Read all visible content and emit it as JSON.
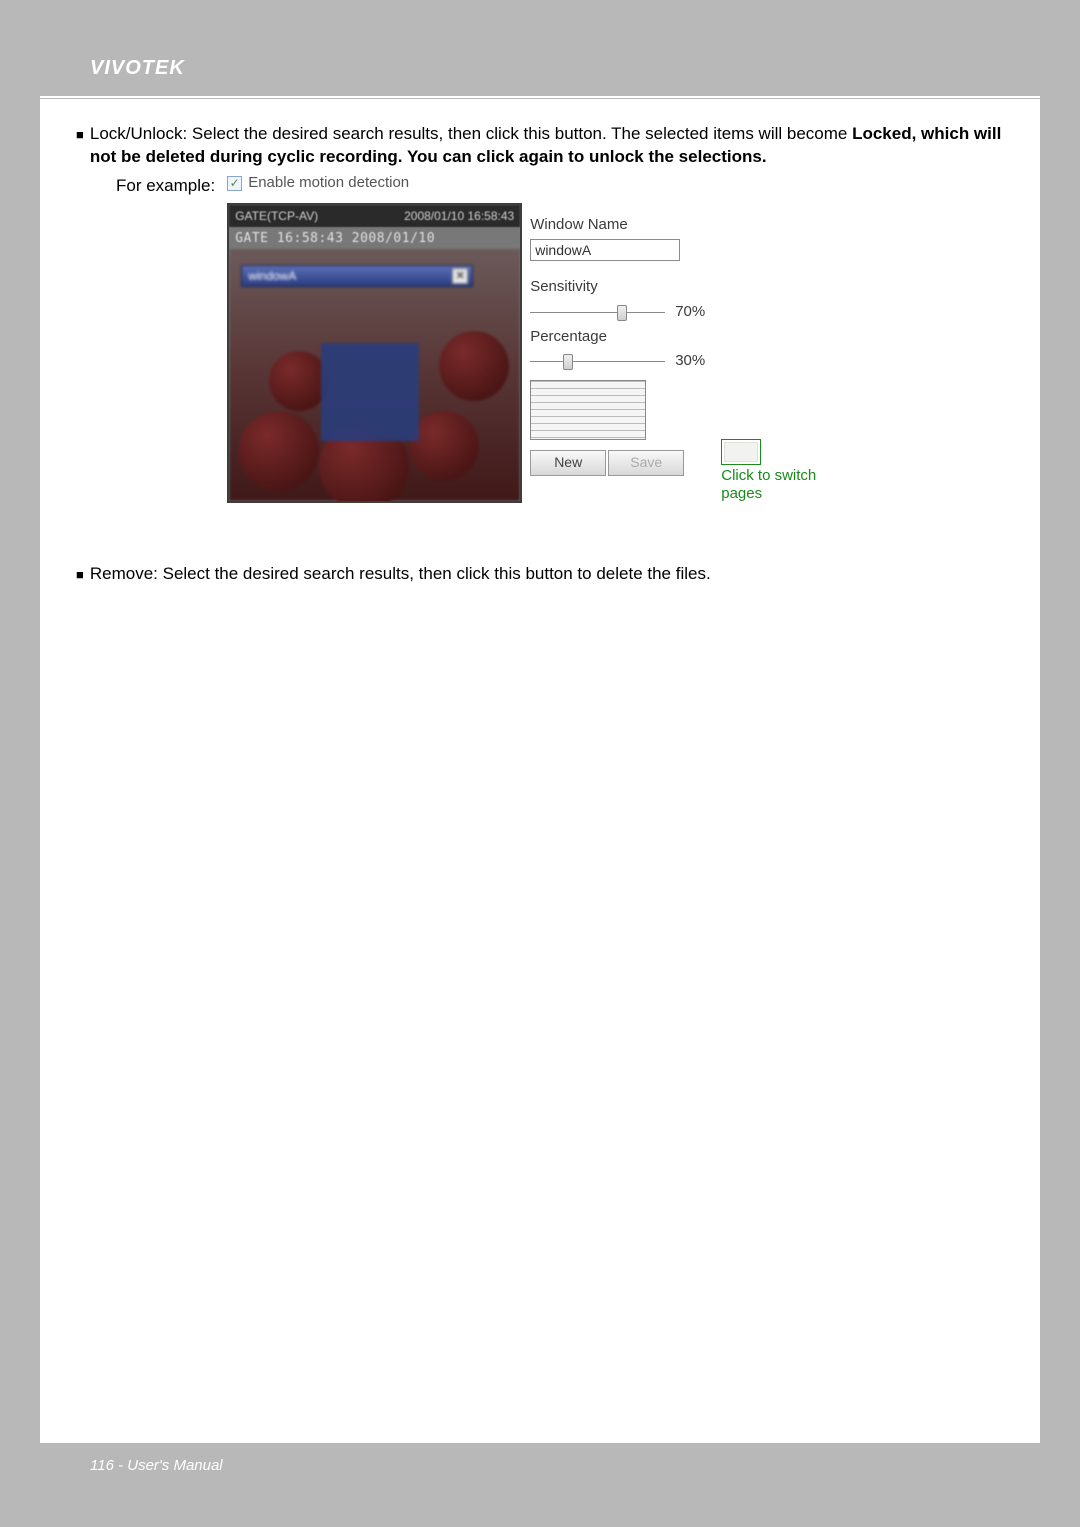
{
  "brand": "VIVOTEK",
  "bullets": {
    "lock_unlock_prefix": "Lock/Unlock: Select the desired search results, then click this button. The selected items will become ",
    "lock_unlock_bold": "Locked, which will not be deleted during cyclic recording. You can click again to unlock the selections.",
    "for_example": "For example:",
    "remove": "Remove: Select the desired search results, then click this button to delete the files."
  },
  "ui": {
    "enable_label": "Enable motion detection",
    "enable_checked": true,
    "video": {
      "title_left": "GATE(TCP-AV)",
      "title_right": "2008/01/10 16:58:43",
      "subtitle": "GATE 16:58:43 2008/01/10",
      "windowA_label": "windowA"
    },
    "controls": {
      "window_name_label": "Window Name",
      "window_name_value": "windowA",
      "sensitivity_label": "Sensitivity",
      "sensitivity_value": "70%",
      "sensitivity_pos_pct": 68,
      "percentage_label": "Percentage",
      "percentage_value": "30%",
      "percentage_pos_pct": 28,
      "new_button": "New",
      "save_button": "Save"
    },
    "annotation": "Click to switch pages"
  },
  "footer": "116 - User's Manual"
}
